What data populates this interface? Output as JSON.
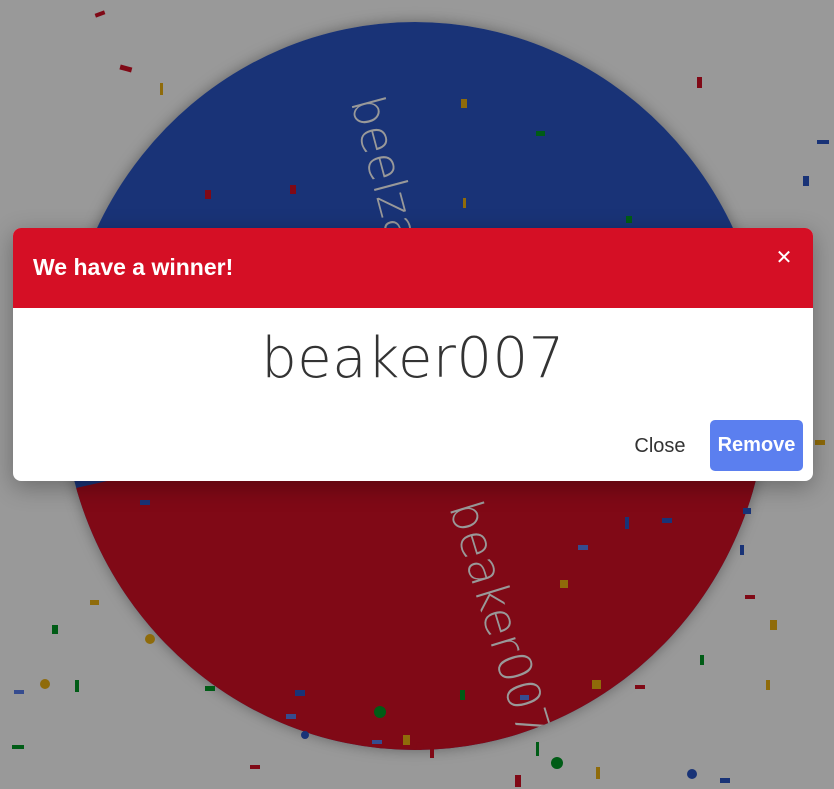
{
  "wheel": {
    "entries": [
      {
        "label": "beelzael",
        "color": "#2a56c6"
      },
      {
        "label": "beaker007",
        "color": "#d50f25"
      }
    ]
  },
  "dialog": {
    "title": "We have a winner!",
    "close_icon": "close-icon",
    "close_glyph": "✕",
    "winner": "beaker007",
    "close_label": "Close",
    "remove_label": "Remove",
    "header_color": "#d50f25",
    "remove_color": "#5b7fef"
  }
}
